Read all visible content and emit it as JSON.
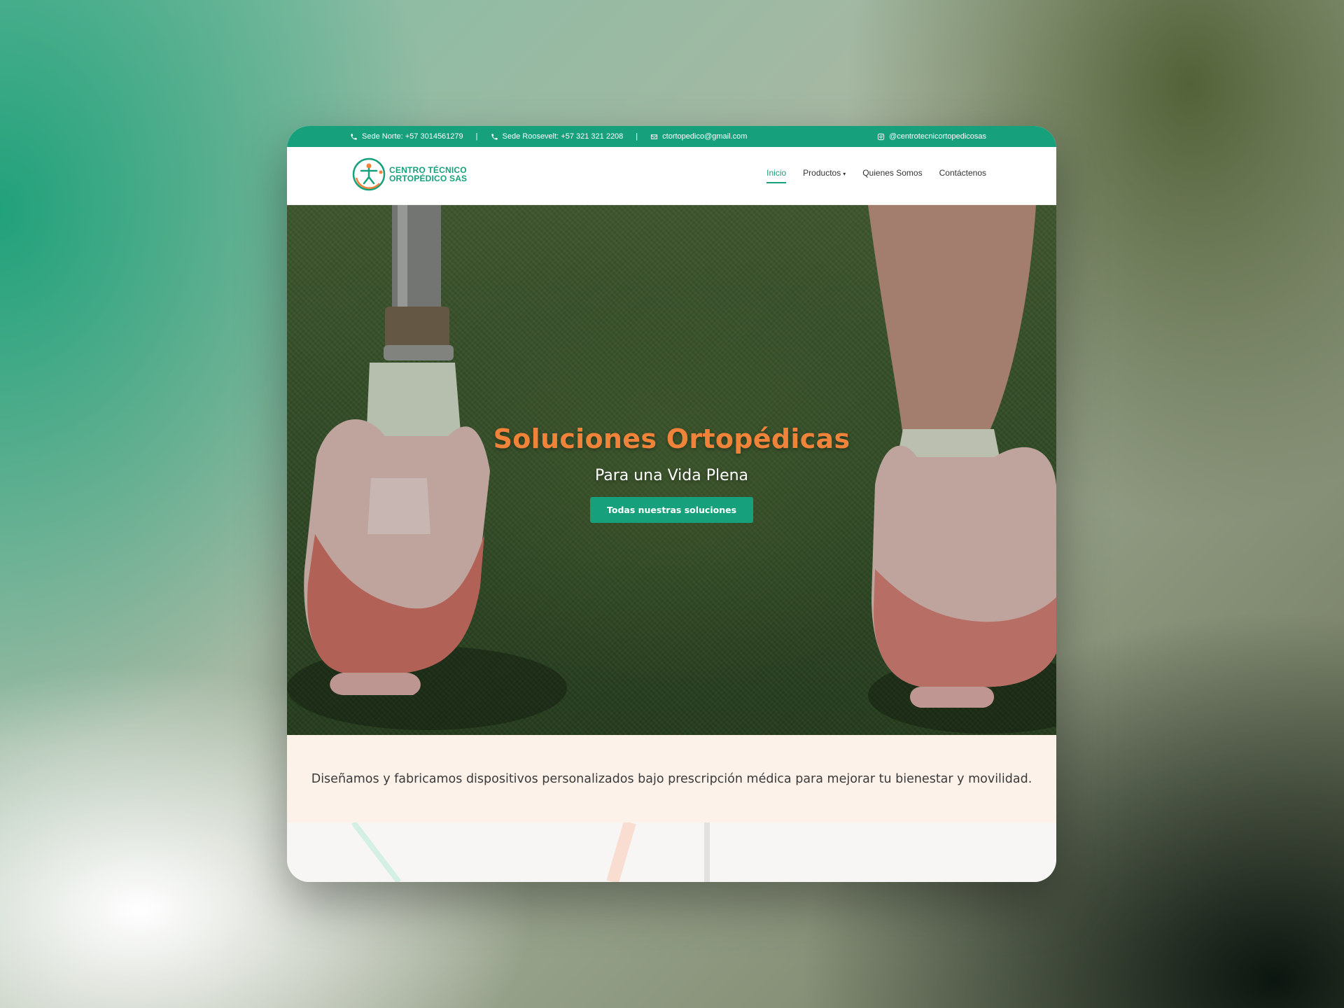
{
  "topbar": {
    "phone_north": "Sede Norte: +57 3014561279",
    "separator": "|",
    "phone_roosevelt": "Sede Roosevelt: +57 321 321 2208",
    "email": "ctortopedico@gmail.com",
    "instagram": "@centrotecnicortopedicosas"
  },
  "brand": {
    "line1": "CENTRO TÉCNICO",
    "line2": "ORTOPÉDICO SAS"
  },
  "nav": {
    "items": [
      {
        "label": "Inicio",
        "active": true
      },
      {
        "label": "Productos",
        "caret": "▾"
      },
      {
        "label": "Quienes Somos"
      },
      {
        "label": "Contáctenos"
      }
    ]
  },
  "hero": {
    "title": "Soluciones Ortopédicas",
    "subtitle": "Para una Vida Plena",
    "cta": "Todas nuestras soluciones"
  },
  "intro": {
    "text": "Diseñamos y fabricamos dispositivos personalizados bajo prescripción médica para mejorar tu bienestar y movilidad."
  },
  "colors": {
    "brand_green": "#17a07c",
    "accent_orange": "#f0833a",
    "intro_bg": "#fcf2ea"
  }
}
